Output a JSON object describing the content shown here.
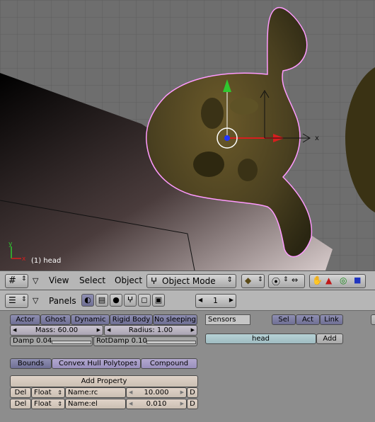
{
  "viewport": {
    "object_label": "(1) head"
  },
  "header": {
    "menus": [
      "View",
      "Select",
      "Object"
    ],
    "mode": "Object Mode"
  },
  "panel": {
    "panels_label": "Panels",
    "frame": "1",
    "physics_buttons": [
      "Actor",
      "Ghost",
      "Dynamic",
      "Rigid Body",
      "No sleeping"
    ],
    "mass_label": "Mass: 60.00",
    "radius_label": "Radius: 1.00",
    "damp_label": "Damp 0.04",
    "rotdamp_label": "RotDamp 0.10",
    "bounds_label": "Bounds",
    "bounds_type": "Convex Hull Polytope",
    "compound_label": "Compound",
    "add_property_label": "Add Property",
    "properties": [
      {
        "del": "Del",
        "type": "Float",
        "name": "Name:rc",
        "value": "10.000",
        "debug": "D"
      },
      {
        "del": "Del",
        "type": "Float",
        "name": "Name:el",
        "value": "0.010",
        "debug": "D"
      }
    ],
    "sensors_label": "Sensors",
    "sel_tabs": [
      "Sel",
      "Act",
      "Link"
    ],
    "object_name": "head",
    "add_label": "Add"
  }
}
